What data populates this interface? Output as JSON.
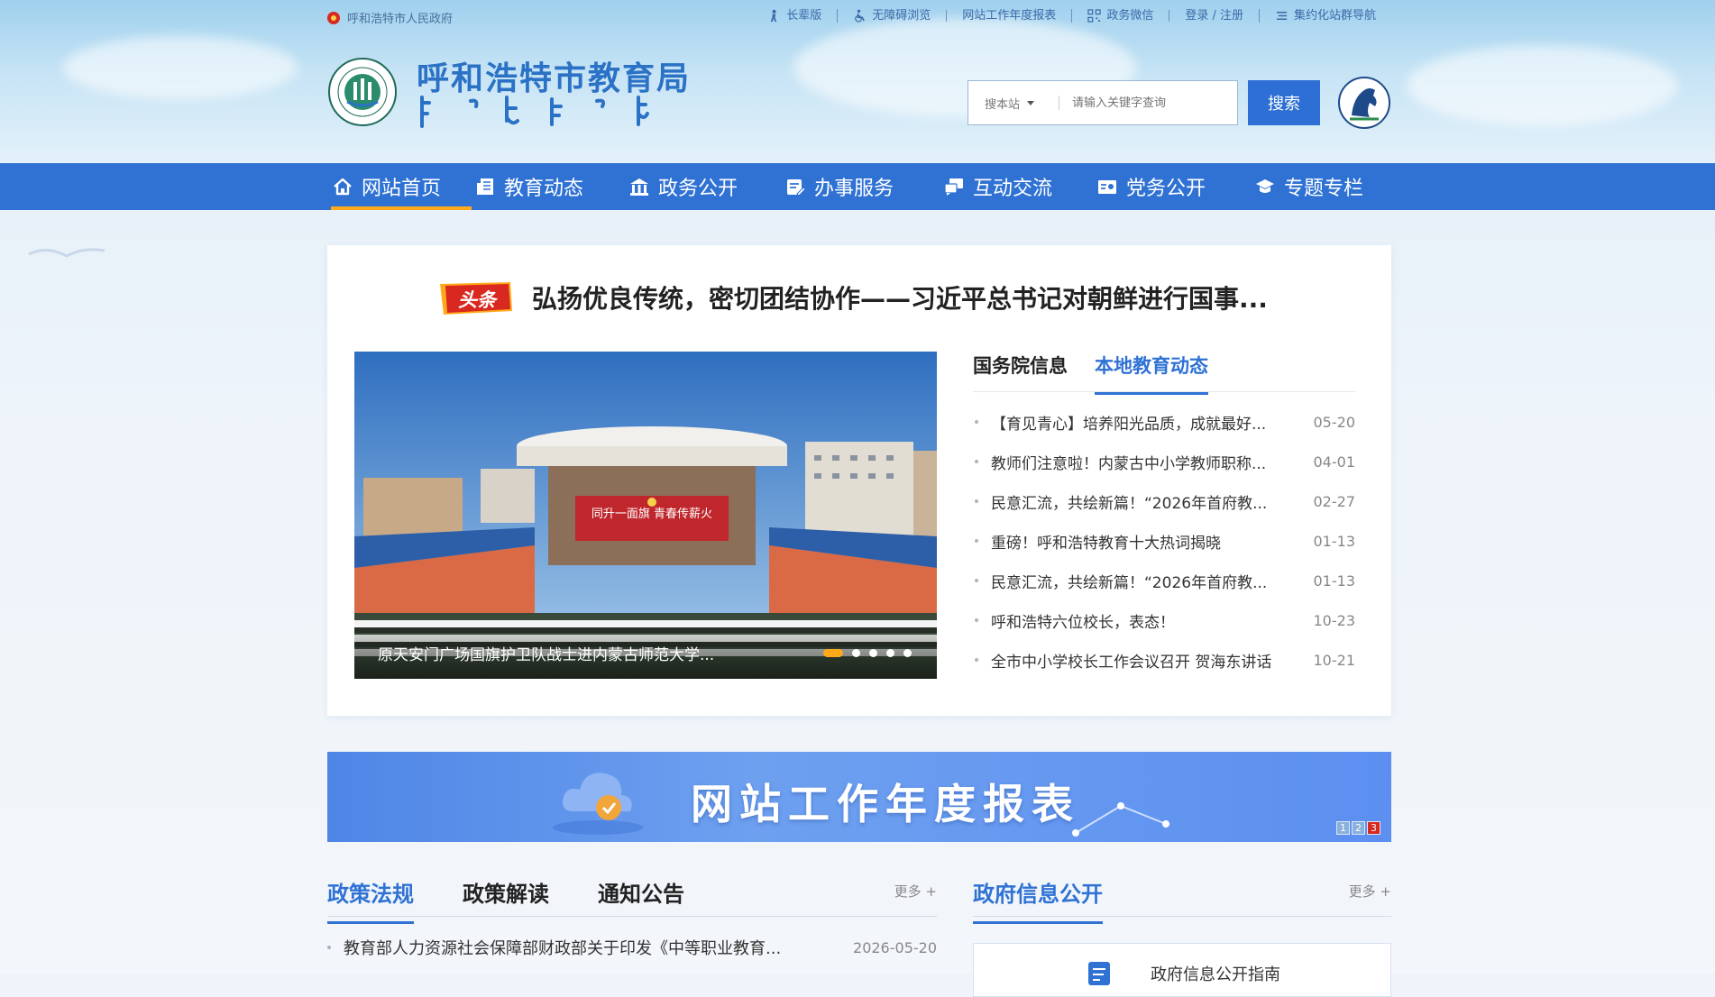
{
  "topbar": {
    "gov_link": "呼和浩特市人民政府",
    "links": [
      {
        "label": "长辈版",
        "icon": "elder-icon"
      },
      {
        "label": "无障碍浏览",
        "icon": "accessibility-icon"
      },
      {
        "label": "网站工作年度报表",
        "icon": ""
      },
      {
        "label": "政务微信",
        "icon": "qrcode-icon"
      },
      {
        "label": "登录 / 注册",
        "icon": ""
      },
      {
        "label": "集约化站群导航",
        "icon": "list-icon"
      }
    ]
  },
  "header": {
    "title": "呼和浩特市教育局",
    "search": {
      "scope": "搜本站",
      "placeholder": "请输入关键字查询",
      "button": "搜索"
    }
  },
  "nav": {
    "items": [
      {
        "label": "网站首页",
        "icon": "home-icon",
        "active": true
      },
      {
        "label": "教育动态",
        "icon": "news-icon"
      },
      {
        "label": "政务公开",
        "icon": "building-icon"
      },
      {
        "label": "办事服务",
        "icon": "service-icon"
      },
      {
        "label": "互动交流",
        "icon": "chat-icon"
      },
      {
        "label": "党务公开",
        "icon": "party-icon"
      },
      {
        "label": "专题专栏",
        "icon": "graduation-icon"
      }
    ]
  },
  "headline": {
    "badge": "头条",
    "text": "弘扬优良传统，密切团结协作——习近平总书记对朝鲜进行国事..."
  },
  "slider": {
    "caption": "原天安门广场国旗护卫队战士进内蒙古师范大学...",
    "banner_text": "同升一面旗 青春传薪火",
    "slide_count": 5,
    "active_slide": 1
  },
  "news": {
    "tabs": [
      {
        "label": "国务院信息",
        "active": false
      },
      {
        "label": "本地教育动态",
        "active": true
      }
    ],
    "items": [
      {
        "title": "【育见青心】培养阳光品质，成就最好...",
        "date": "05-20"
      },
      {
        "title": "教师们注意啦！内蒙古中小学教师职称...",
        "date": "04-01"
      },
      {
        "title": "民意汇流，共绘新篇！“2026年首府教...",
        "date": "02-27"
      },
      {
        "title": "重磅！呼和浩特教育十大热词揭晓",
        "date": "01-13"
      },
      {
        "title": "民意汇流，共绘新篇！“2026年首府教...",
        "date": "01-13"
      },
      {
        "title": "呼和浩特六位校长，表态！",
        "date": "10-23"
      },
      {
        "title": "全市中小学校长工作会议召开 贺海东讲话",
        "date": "10-21"
      }
    ]
  },
  "banner": {
    "title": "网站工作年度报表",
    "pages": [
      "1",
      "2",
      "3"
    ],
    "active_page": 3
  },
  "policy": {
    "tabs": [
      {
        "label": "政策法规",
        "active": true
      },
      {
        "label": "政策解读",
        "active": false
      },
      {
        "label": "通知公告",
        "active": false
      }
    ],
    "more": "更多 +",
    "items": [
      {
        "title": "教育部人力资源社会保障部财政部关于印发《中等职业教育...",
        "date": "2026-05-20"
      }
    ]
  },
  "gov_info": {
    "title": "政府信息公开",
    "more": "更多 +",
    "guide": "政府信息公开指南"
  },
  "colors": {
    "brand_blue": "#2f72d4",
    "accent_orange": "#ffa91a",
    "badge_red": "#d8281f"
  }
}
